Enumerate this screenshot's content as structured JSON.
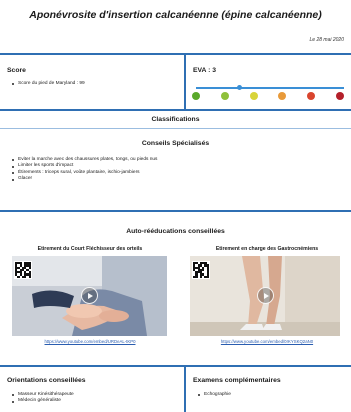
{
  "title": "Aponévrosite d'insertion calcanéenne (épine calcanéenne)",
  "date": "Le 28 mai 2020",
  "score": {
    "heading": "Score",
    "items": [
      "Score du pied de Maryland : 99"
    ]
  },
  "eva": {
    "heading": "EVA : 3",
    "value": 3,
    "max": 10,
    "dot_colors": [
      "#5aa92a",
      "#8fc03a",
      "#d8d43a",
      "#e89a3a",
      "#d9452e",
      "#b4202a"
    ]
  },
  "classifications": {
    "heading": "Classifications"
  },
  "conseils": {
    "heading": "Conseils Spécialisés",
    "items": [
      "Eviter la marche avec des chaussures plates, tongs, ou pieds nus",
      "Limiter les sports d'impact",
      "Étirements : triceps sural, voûte plantaire, ischio-jambiers",
      "Glacer"
    ]
  },
  "auto_reeducations": {
    "heading": "Auto-rééducations conseillées",
    "videos": [
      {
        "title": "Etirement du Court Fléchisseur des orteils",
        "url": "https://www.youtube.com/embed/URDeAL-tKP0"
      },
      {
        "title": "Etirement en charge des Gastrocnémiens",
        "url": "https://www.youtube.com/embed/0rKYSKQ2aN0"
      }
    ]
  },
  "orientations": {
    "heading": "Orientations conseillées",
    "items": [
      "Masseur Kinésithérapeute",
      "Médecin généraliste"
    ]
  },
  "examens": {
    "heading": "Examens complémentaires",
    "items": [
      "Echographie"
    ]
  }
}
